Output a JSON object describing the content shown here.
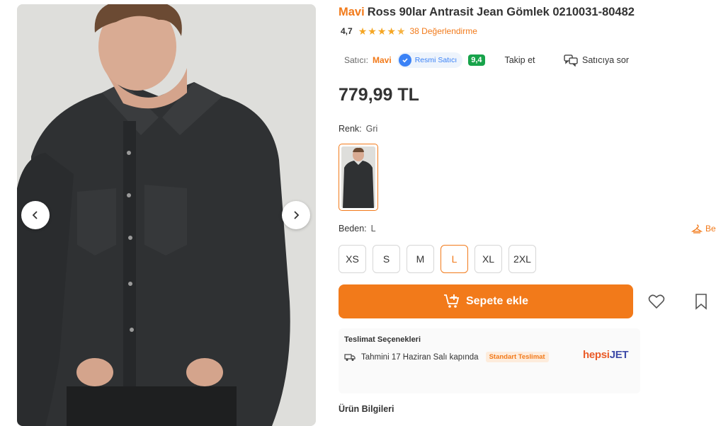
{
  "product": {
    "brand": "Mavi",
    "title": "Ross 90lar Antrasit Jean Gömlek 0210031-80482",
    "rating": "4,7",
    "stars": 4.7,
    "reviews": "38 Değerlendirme",
    "price": "779,99 TL"
  },
  "seller": {
    "label": "Satıcı:",
    "name": "Mavi",
    "official_label": "Resmi Satıcı",
    "score": "9,4",
    "follow_label": "Takip et",
    "ask_label": "Satıcıya sor"
  },
  "color": {
    "label": "Renk:",
    "value": "Gri"
  },
  "size": {
    "label": "Beden:",
    "value": "L",
    "guide_label": "Be",
    "options": [
      "XS",
      "S",
      "M",
      "L",
      "XL",
      "2XL"
    ],
    "selected": "L"
  },
  "actions": {
    "add_to_cart": "Sepete ekle"
  },
  "delivery": {
    "title": "Teslimat Seçenekleri",
    "estimate": "Tahmini 17 Haziran Salı kapında",
    "badge": "Standart Teslimat",
    "carrier_part1": "hepsi",
    "carrier_part2": "JET"
  },
  "product_info_heading": "Ürün Bilgileri",
  "colors": {
    "accent": "#f27a1a",
    "verified": "#3b82f6",
    "score_bg": "#17a34a"
  },
  "icons": {
    "prev": "chevron-left-icon",
    "next": "chevron-right-icon",
    "cart": "cart-plus-icon",
    "favorite": "heart-icon",
    "bookmark": "bookmark-icon",
    "truck": "truck-icon",
    "chat": "chat-icon",
    "size_guide": "hanger-icon"
  }
}
